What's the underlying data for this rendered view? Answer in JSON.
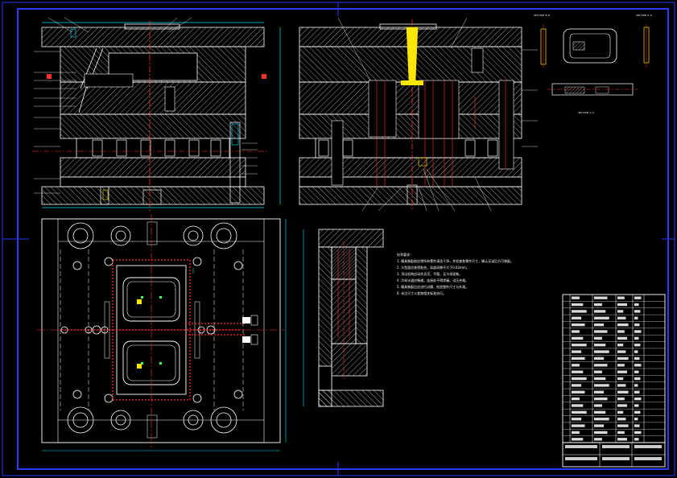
{
  "sheet": {
    "title_block": {
      "rows": 22
    },
    "section_labels": [
      "SECTION  B-B",
      "SECTION  D-D",
      "SECTION  A-A"
    ],
    "notes_heading": "技术要求：",
    "notes_lines": [
      "1. 模具装配前应将所有零件清洗干净，并检查各零件尺寸，确认无误后方可装配。",
      "2. 分型面应紧密贴合，局部间隙不大于0.02mm。",
      "3. 顶出机构应动作灵活、平稳，无卡滞现象。",
      "4. 冷却水道应畅通，连接处不得渗漏，试压合格。",
      "5. 模具装配后应进行试模，检验塑件尺寸与外观。",
      "6. 未注尺寸公差按相关标准执行。"
    ],
    "colors": {
      "background": "#000000",
      "frame_blue": "#2a3bff",
      "outline": "#ffffff",
      "centerline": "#ff3030",
      "cyan": "#00e5ff",
      "yellow": "#ffe600",
      "green": "#39ff5a",
      "magenta": "#ff40ff"
    }
  }
}
